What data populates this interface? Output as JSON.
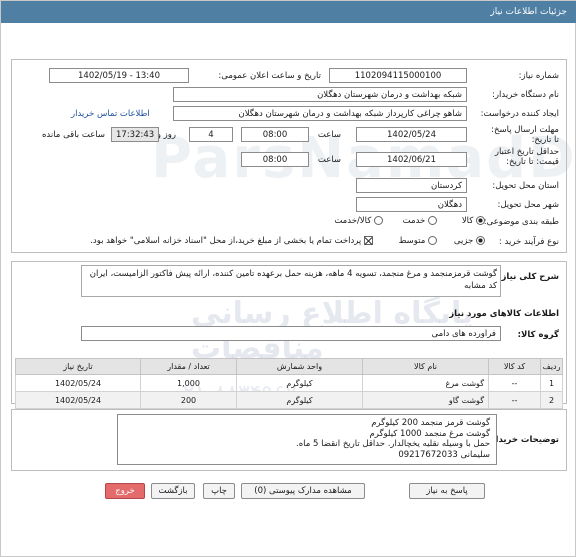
{
  "header": {
    "title": "جزئیات اطلاعات نیاز"
  },
  "need_number": {
    "label": "شماره نیاز:",
    "value": "1102094115000100"
  },
  "announce_datetime": {
    "label": "تاریخ و ساعت اعلان عمومی:",
    "value": "1402/05/19 - 13:40"
  },
  "buyer_org": {
    "label": "نام دستگاه خریدار:",
    "value": "شبکه بهداشت و درمان شهرستان دهگلان"
  },
  "requester": {
    "label": "ایجاد کننده درخواست:",
    "value": "شاهو چراغی کارپرداز شبکه بهداشت و درمان شهرستان دهگلان",
    "contact_link": "اطلاعات تماس خریدار"
  },
  "send_deadline": {
    "label": "مهلت ارسال پاسخ: تا تاریخ:",
    "date": "1402/05/24",
    "time_label": "ساعت",
    "time": "08:00",
    "days": "4",
    "days_label": "روز و",
    "remaining": "17:32:43",
    "remaining_label": "ساعت باقی مانده"
  },
  "price_validity": {
    "label": "حداقل تاریخ اعتبار قیمت: تا تاریخ:",
    "date": "1402/06/21",
    "time_label": "ساعت",
    "time": "08:00"
  },
  "province": {
    "label": "استان محل تحویل:",
    "value": "کردستان"
  },
  "city": {
    "label": "شهر محل تحویل:",
    "value": "دهگلان"
  },
  "category": {
    "label": "طبقه بندی موضوعی:",
    "options": [
      "کالا",
      "خدمت",
      "کالا/خدمت"
    ],
    "selected": "کالا"
  },
  "process_type": {
    "label": "نوع فرآیند خرید :",
    "options": [
      "جزیی",
      "متوسط"
    ],
    "selected": "جزیی",
    "payment_note": "پرداخت تمام یا بخشی از مبلغ خرید،از محل \"اسناد خزانه اسلامی\" خواهد بود."
  },
  "general_description": {
    "label": "شرح کلی نیاز:",
    "value": "گوشت قرمزمنجمد و مرغ منجمد، تسویه 4 ماهه، هزینه حمل برعهده تامین کننده، ارائه پیش فاکتور الزامیست، ایران کد مشابه"
  },
  "goods_info": {
    "title": "اطلاعات کالاهای مورد نیاز",
    "group_label": "گروه کالا:",
    "group_value": "فراورده های دامی",
    "columns": [
      "ردیف",
      "کد کالا",
      "نام کالا",
      "واحد شمارش",
      "تعداد / مقدار",
      "تاریخ نیاز"
    ],
    "rows": [
      {
        "row": "1",
        "code": "--",
        "name": "گوشت مرغ",
        "unit": "کیلوگرم",
        "qty": "1,000",
        "date": "1402/05/24"
      },
      {
        "row": "2",
        "code": "--",
        "name": "گوشت گاو",
        "unit": "کیلوگرم",
        "qty": "200",
        "date": "1402/05/24"
      }
    ]
  },
  "buyer_notes": {
    "label": "توضیحات خریدار:",
    "lines": [
      "گوشت قرمز منجمد 200 کیلوگرم",
      "گوشت مرغ منجمد 1000 کیلوگرم",
      "حمل با وسیله نقلیه یخچالدار. حداقل تاریخ انقضا 5 ماه.",
      "سلیمانی 09217672033"
    ]
  },
  "buttons": {
    "reply": "پاسخ به نیاز",
    "view_docs": "مشاهده مدارک پیوستی (0)",
    "print": "چاپ",
    "back": "بازگشت",
    "exit": "خروج"
  },
  "watermark": {
    "line1": "ParsNamadData",
    "line2": "پایگاه اطلاع رسانی مناقصات",
    "line3": "۰۲۱-۸۸۳۴۹۶۷۰"
  },
  "colors": {
    "header_bg": "#4f7fa3",
    "exit_button": "#e36b6b",
    "link": "#1d4f9e"
  }
}
